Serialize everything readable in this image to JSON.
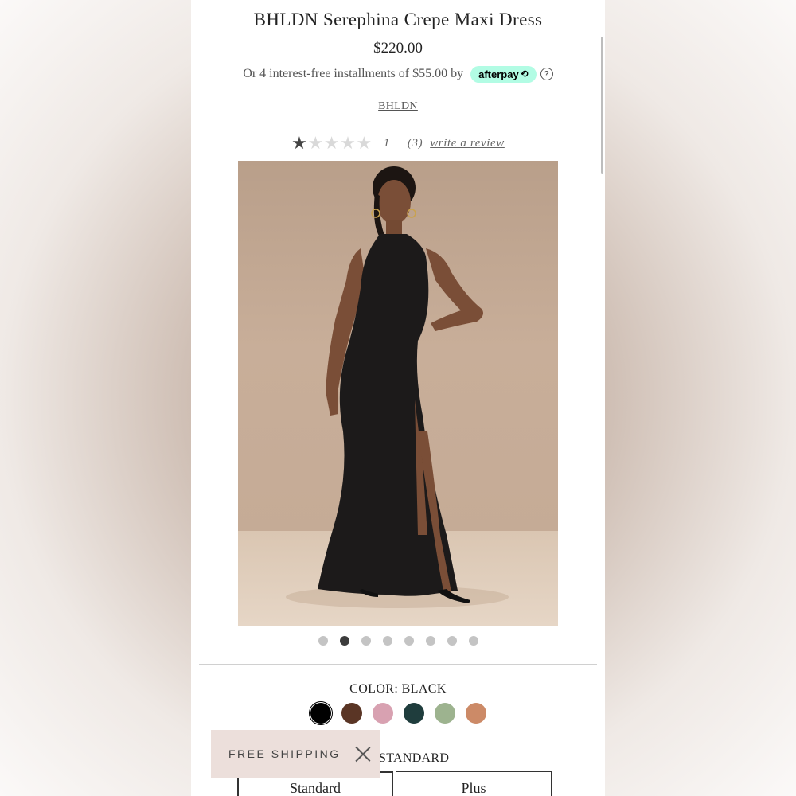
{
  "product": {
    "title": "BHLDN Serephina Crepe Maxi Dress",
    "price": "$220.00",
    "installments_text": "Or 4 interest-free installments of $55.00 by",
    "afterpay_label": "afterpay",
    "help_glyph": "?",
    "brand": "BHLDN"
  },
  "rating": {
    "stars_filled": 1,
    "stars_total": 5,
    "value": "1",
    "count": "(3)",
    "write_review": "write a review"
  },
  "gallery": {
    "image_alt": "Model wearing black halter crepe maxi dress with side slit",
    "dot_count": 8,
    "active_index": 1
  },
  "color": {
    "label": "COLOR: BLACK",
    "swatches": [
      {
        "name": "black",
        "hex": "#000000",
        "selected": true
      },
      {
        "name": "brown",
        "hex": "#5a3525",
        "selected": false
      },
      {
        "name": "pink",
        "hex": "#d8a1b1",
        "selected": false
      },
      {
        "name": "dark-green",
        "hex": "#1f3d3d",
        "selected": false
      },
      {
        "name": "sage",
        "hex": "#9db38f",
        "selected": false
      },
      {
        "name": "terracotta",
        "hex": "#cc8a67",
        "selected": false
      }
    ]
  },
  "size": {
    "heading": "STANDARD",
    "options": [
      "Standard",
      "Plus"
    ]
  },
  "banner": {
    "text": "FREE SHIPPING",
    "close_icon": "close-icon"
  },
  "colors": {
    "afterpay_mint": "#b2fce4",
    "banner_bg": "#ecdfdb",
    "photo_bg": "#c2a995"
  }
}
